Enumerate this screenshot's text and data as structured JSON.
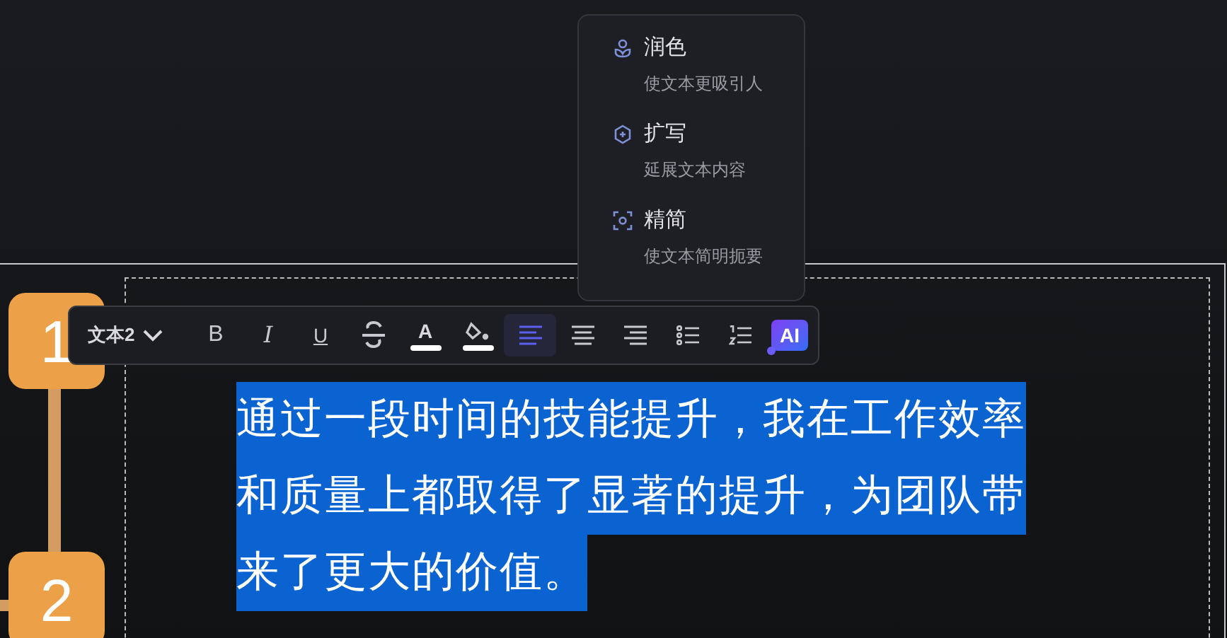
{
  "ai_menu": [
    {
      "kind": "polish",
      "title": "润色",
      "description": "使文本更吸引人"
    },
    {
      "kind": "expand",
      "title": "扩写",
      "description": "延展文本内容"
    },
    {
      "kind": "simplify",
      "title": "精简",
      "description": "使文本简明扼要"
    }
  ],
  "steps": [
    {
      "label": "1"
    },
    {
      "label": "2"
    }
  ],
  "toolbar": {
    "style_dropdown": "文本2",
    "tools": [
      {
        "kind": "bold",
        "glyph": "B",
        "selected": false
      },
      {
        "kind": "italic",
        "glyph": "I",
        "selected": false
      },
      {
        "kind": "underline",
        "glyph": "U",
        "selected": false
      },
      {
        "kind": "strike",
        "selected": false
      },
      {
        "kind": "text_color",
        "glyph": "A",
        "selected": false
      },
      {
        "kind": "fill",
        "selected": false
      },
      {
        "kind": "align_left",
        "selected": true
      },
      {
        "kind": "align_center",
        "selected": false
      },
      {
        "kind": "align_right",
        "selected": false
      },
      {
        "kind": "bullet_list",
        "selected": false
      },
      {
        "kind": "numbered_list",
        "selected": false
      }
    ],
    "ai_button": "AI"
  },
  "selected_text": [
    "通过一段时间的技能提升，我在工作效率",
    "和质量上都取得了显著的提升，为团队带",
    "来了更大的价值。"
  ]
}
